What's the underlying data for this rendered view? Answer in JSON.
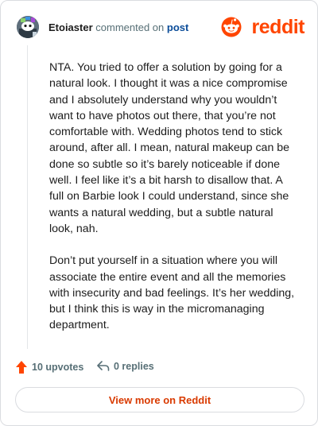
{
  "header": {
    "username": "Etoiaster",
    "action_text": "commented on",
    "post_link": "post",
    "logo_text": "reddit"
  },
  "comment": {
    "paragraphs": [
      "NTA. You tried to offer a solution by going for a natural look. I thought it was a nice compromise and I absolutely understand why you wouldn’t want to have photos out there, that you’re not comfortable with. Wedding photos tend to stick around, after all. I mean, natural makeup can be done so subtle so it’s barely noticeable if done well. I feel like it’s a bit harsh to disallow that. A full on Barbie look I could understand, since she wants a natural wedding, but a subtle natural look, nah.",
      "Don’t put yourself in a situation where you will associate the entire event and all the memories with insecurity and bad feelings. It’s her wedding, but I think this is way in the micromanaging department."
    ]
  },
  "footer": {
    "upvotes_label": "10 upvotes",
    "replies_label": "0 replies"
  },
  "view_more_label": "View more on Reddit",
  "colors": {
    "brand": "#ff4500",
    "link": "#0a4c99",
    "view_more": "#d93a00",
    "muted": "#576f76"
  },
  "icons": {
    "avatar": "snoo-avatar",
    "logo": "reddit-snoo-icon",
    "upvote": "upvote-arrow-icon",
    "reply": "reply-arrow-icon"
  }
}
